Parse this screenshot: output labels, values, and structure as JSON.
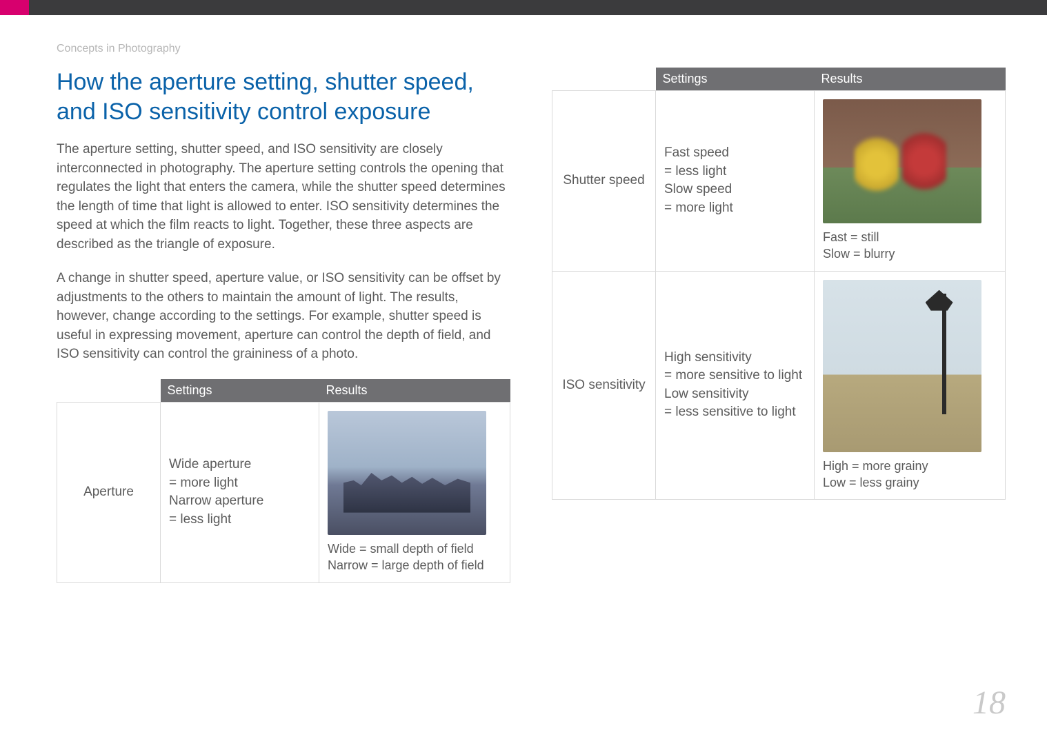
{
  "breadcrumb": "Concepts in Photography",
  "title": "How the aperture setting, shutter speed, and ISO sensitivity control exposure",
  "para1": "The aperture setting, shutter speed, and ISO sensitivity are closely interconnected in photography. The aperture setting controls the opening that regulates the light that enters the camera, while the shutter speed determines the length of time that light is allowed to enter. ISO sensitivity determines the speed at which the film reacts to light. Together, these three aspects are described as the triangle of exposure.",
  "para2": "A change in shutter speed, aperture value, or ISO sensitivity can be offset by adjustments to the others to maintain the amount of light. The results, however, change according to the settings. For example, shutter speed is useful in expressing movement, aperture can control the depth of field, and ISO sensitivity can control the graininess of a photo.",
  "headers": {
    "settings": "Settings",
    "results": "Results"
  },
  "rows": {
    "aperture": {
      "label": "Aperture",
      "settings": "Wide aperture\n= more light\nNarrow aperture\n= less light",
      "results_caption": "Wide = small depth of field\nNarrow = large depth of field"
    },
    "shutter": {
      "label": "Shutter speed",
      "settings": "Fast speed\n= less light\nSlow speed\n= more light",
      "results_caption": "Fast = still\nSlow = blurry"
    },
    "iso": {
      "label": "ISO sensitivity",
      "settings": "High sensitivity\n= more sensitive to light\nLow sensitivity\n= less sensitive to light",
      "results_caption": "High = more grainy\nLow = less grainy"
    }
  },
  "page_number": "18"
}
